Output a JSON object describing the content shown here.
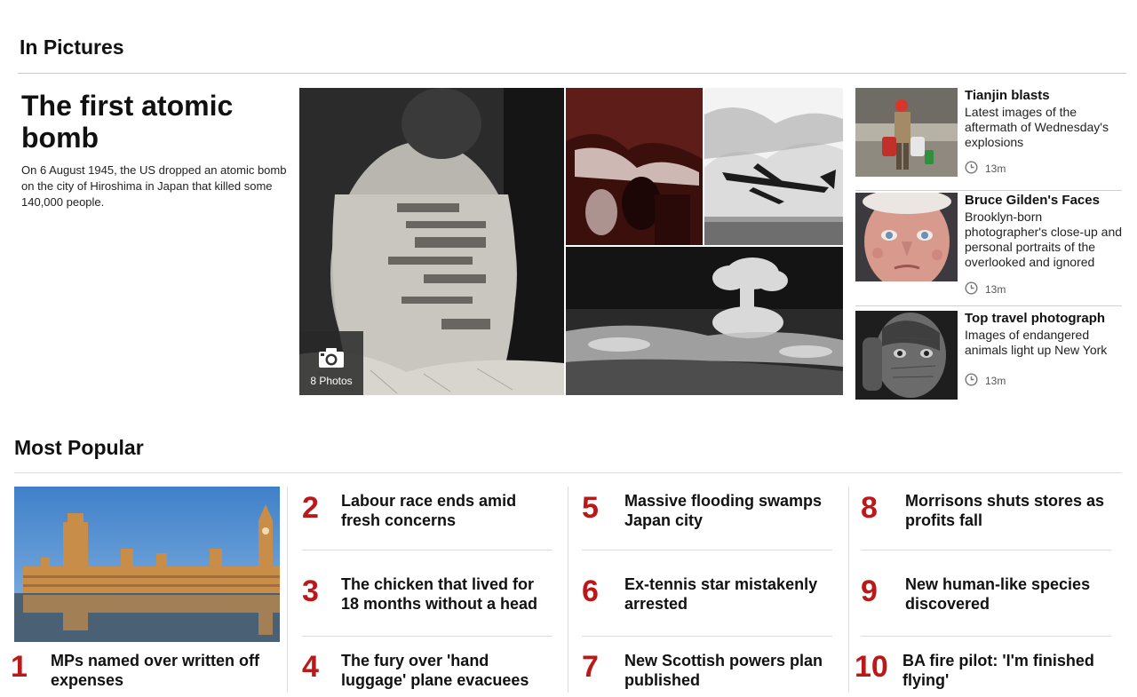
{
  "in_pictures": {
    "section_title": "In Pictures",
    "hero": {
      "title": "The first atomic bomb",
      "summary": "On 6 August 1945, the US dropped an atomic bomb on the city of Hiroshima in Japan that killed some 140,000 people.",
      "photo_count": "8 Photos"
    },
    "side_items": [
      {
        "title": "Tianjin blasts",
        "summary": "Latest images of the aftermath of Wednesday's explosions",
        "time": "13m"
      },
      {
        "title": "Bruce Gilden's Faces",
        "summary": "Brooklyn-born photographer's close-up and personal portraits of the overlooked and ignored",
        "time": "13m"
      },
      {
        "title": "Top travel photograph",
        "summary": "Images of endangered animals light up New York",
        "time": "13m"
      }
    ]
  },
  "most_popular": {
    "section_title": "Most Popular",
    "items": [
      {
        "rank": "1",
        "title": "MPs named over written off expenses"
      },
      {
        "rank": "2",
        "title": "Labour race ends amid fresh concerns"
      },
      {
        "rank": "3",
        "title": "The chicken that lived for 18 months without a head"
      },
      {
        "rank": "4",
        "title": "The fury over 'hand luggage' plane evacuees"
      },
      {
        "rank": "5",
        "title": "Massive flooding swamps Japan city"
      },
      {
        "rank": "6",
        "title": "Ex-tennis star mistakenly arrested"
      },
      {
        "rank": "7",
        "title": "New Scottish powers plan published"
      },
      {
        "rank": "8",
        "title": "Morrisons shuts stores as profits fall"
      },
      {
        "rank": "9",
        "title": "New human-like species discovered"
      },
      {
        "rank": "10",
        "title": "BA fire pilot: 'I'm finished flying'"
      }
    ]
  },
  "colors": {
    "rank_red": "#bb1919",
    "rule_grey": "#c8c8c8",
    "badge_bg": "#282828"
  },
  "icons": {
    "photo_badge": "camera-icon",
    "timestamp": "clock-icon"
  }
}
